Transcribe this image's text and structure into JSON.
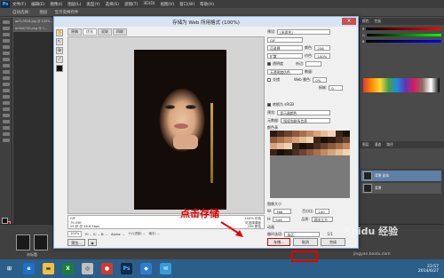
{
  "ps": {
    "logo": "Ps",
    "menu": [
      "文件(F)",
      "编辑(E)",
      "图像(I)",
      "图层(L)",
      "类型(Y)",
      "选择(S)",
      "滤镜(T)",
      "3D(D)",
      "视图(V)",
      "窗口(W)",
      "帮助(H)"
    ],
    "options": [
      "自动选择：",
      "图层",
      "显示变换控件"
    ],
    "doc_tabs": [
      "ae7c3928.jpg @ 100%...",
      "ec5d4730.png @ 1..."
    ],
    "right_tabs": [
      "颜色",
      "色板"
    ],
    "layer_tabs": [
      "图层",
      "通道",
      "路径"
    ],
    "layers": [
      "背景 副本",
      "背景"
    ],
    "filmstrip_label": "未标题"
  },
  "dialog": {
    "title": "存储为 Web 所用格式 (100%)",
    "tabs": [
      "原稿",
      "优化",
      "双联",
      "四联"
    ],
    "info_left": [
      "GIF",
      "79.53K",
      "29 秒 @ 56.6 Kbps"
    ],
    "info_right": [
      "100% 仿色",
      "可选择调板",
      "256 颜色"
    ],
    "zoom": "100%",
    "rgb_label": "R: --  G: --  B: --",
    "alpha": "Alpha: --",
    "hex": "十六进制: --",
    "index": "索引: --",
    "preview_btn": "预览...",
    "preset_label": "预设:",
    "preset": "[未命名]",
    "format": "GIF",
    "reduction": "可选择",
    "colors_label": "颜色:",
    "colors": "256",
    "dither_algo": "扩散",
    "dither_label": "仿色:",
    "dither": "100%",
    "transparency": "透明度",
    "matte_label": "杂边:",
    "transparency_dither": "无透明度仿色",
    "amount_label": "数量:",
    "interlaced": "交错",
    "web_snap_label": "Web 靠色:",
    "web_snap": "0%",
    "lossy_label": "损耗:",
    "lossy": "0",
    "convert_srgb": "转换为 sRGB",
    "preview_mode_label": "预览:",
    "preview_mode": "显示器颜色",
    "metadata_label": "元数据:",
    "metadata": "版权和联系信息",
    "color_table_label": "颜色表",
    "image_size_label": "图像大小",
    "width_label": "W:",
    "width": "368",
    "height_label": "H:",
    "height": "546",
    "percent_label": "百分比:",
    "percent": "100",
    "quality_label": "品质:",
    "quality": "两次立方",
    "animation_label": "动画",
    "loop_label": "循环选项:",
    "loop": "永远",
    "frame": "1/1",
    "save_btn": "存储...",
    "cancel_btn": "取消",
    "done_btn": "完成"
  },
  "annotation": "点击存储",
  "taskbar": {
    "clock_time": "23:57",
    "clock_date": "2014/6/27"
  },
  "watermark": "Baidu 经验",
  "watermark_url": "jingyan.baidu.com"
}
